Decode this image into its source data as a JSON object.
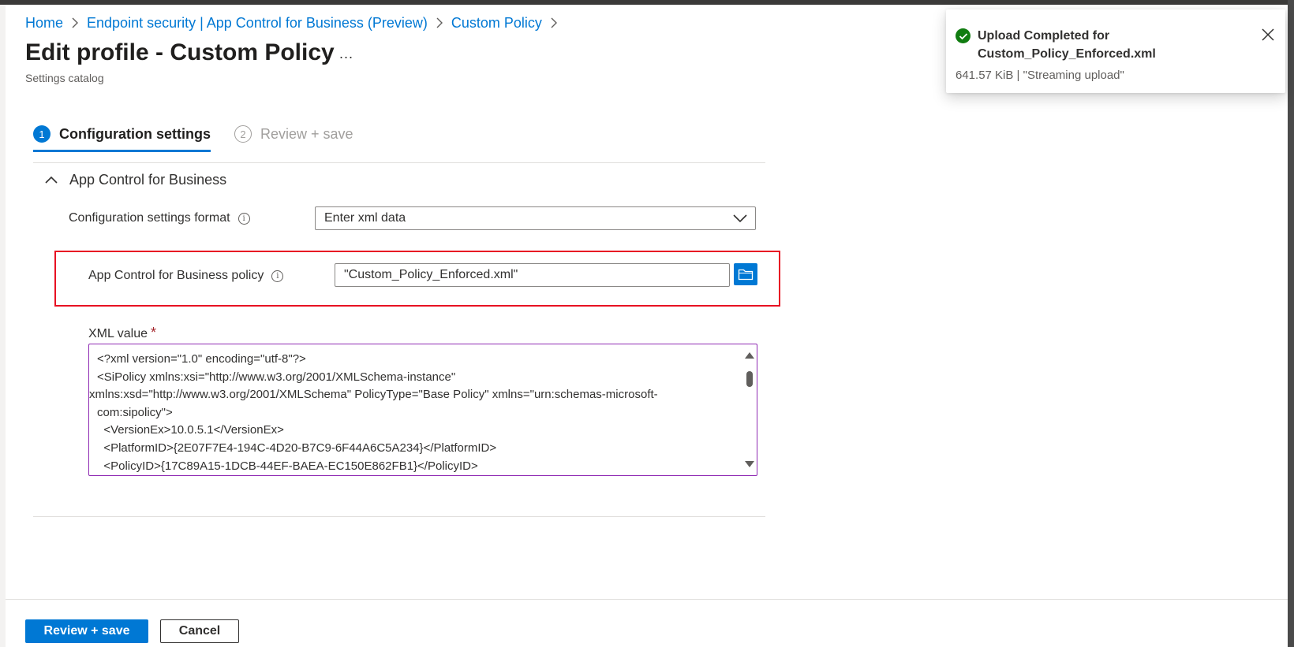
{
  "breadcrumb": {
    "items": [
      {
        "label": "Home"
      },
      {
        "label": "Endpoint security | App Control for Business (Preview)"
      },
      {
        "label": "Custom Policy"
      }
    ]
  },
  "header": {
    "title": "Edit profile - Custom Policy",
    "more": "...",
    "subtitle": "Settings catalog"
  },
  "steps": [
    {
      "number": "1",
      "label": "Configuration settings",
      "active": true
    },
    {
      "number": "2",
      "label": "Review + save",
      "active": false
    }
  ],
  "section": {
    "title": "App Control for Business",
    "format_label": "Configuration settings format",
    "format_value": "Enter xml data",
    "policy_label": "App Control for Business policy",
    "policy_value": "\"Custom_Policy_Enforced.xml\"",
    "xml_label": "XML value",
    "required_marker": "*",
    "xml_lines": [
      "<?xml version=\"1.0\" encoding=\"utf-8\"?>",
      "<SiPolicy xmlns:xsi=\"http://www.w3.org/2001/XMLSchema-instance\"",
      "xmlns:xsd=\"http://www.w3.org/2001/XMLSchema\" PolicyType=\"Base Policy\" xmlns=\"urn:schemas-microsoft-",
      "com:sipolicy\">",
      "  <VersionEx>10.0.5.1</VersionEx>",
      "  <PlatformID>{2E07F7E4-194C-4D20-B7C9-6F44A6C5A234}</PlatformID>",
      "  <PolicyID>{17C89A15-1DCB-44EF-BAEA-EC150E862FB1}</PolicyID>"
    ]
  },
  "footer": {
    "primary_label": "Review + save",
    "secondary_label": "Cancel"
  },
  "toast": {
    "title": "Upload Completed for Custom_Policy_Enforced.xml",
    "detail": "641.57 KiB | \"Streaming upload\""
  },
  "colors": {
    "accent": "#0078d4",
    "success": "#107c10",
    "highlight": "#e81123",
    "required": "#a4262c"
  }
}
